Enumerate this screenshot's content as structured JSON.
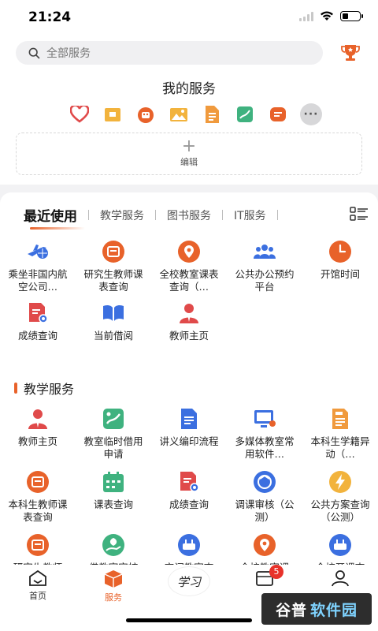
{
  "status": {
    "time": "21:24"
  },
  "search": {
    "placeholder": "全部服务"
  },
  "my_services": {
    "title": "我的服务",
    "edit_label": "编辑"
  },
  "tabs": [
    "最近使用",
    "教学服务",
    "图书服务",
    "IT服务"
  ],
  "recent": [
    {
      "name": "乘坐非国内航空公司…",
      "icon": "airplane-icon"
    },
    {
      "name": "研究生教师课表查询",
      "icon": "schedule-icon"
    },
    {
      "name": "全校教室课表查询（…",
      "icon": "location-pin-icon"
    },
    {
      "name": "公共办公预约平台",
      "icon": "people-icon"
    },
    {
      "name": "开馆时间",
      "icon": "clock-icon"
    },
    {
      "name": "成绩查询",
      "icon": "grade-search-icon"
    },
    {
      "name": "当前借阅",
      "icon": "book-icon"
    },
    {
      "name": "教师主页",
      "icon": "teacher-icon"
    }
  ],
  "teaching_section": {
    "title": "教学服务"
  },
  "teaching": [
    {
      "name": "教师主页",
      "icon": "teacher-icon"
    },
    {
      "name": "教室临时借用申请",
      "icon": "classroom-borrow-icon"
    },
    {
      "name": "讲义编印流程",
      "icon": "document-icon"
    },
    {
      "name": "多媒体教室常用软件…",
      "icon": "monitor-icon"
    },
    {
      "name": "本科生学籍异动（…",
      "icon": "student-status-icon"
    },
    {
      "name": "本科生教师课表查询",
      "icon": "schedule-icon"
    },
    {
      "name": "课表查询",
      "icon": "calendar-icon"
    },
    {
      "name": "成绩查询",
      "icon": "grade-search-icon"
    },
    {
      "name": "调课审核（公测）",
      "icon": "swap-icon"
    },
    {
      "name": "公共方案查询（公测）",
      "icon": "lightning-icon"
    },
    {
      "name": "研究生教师",
      "icon": "schedule-icon"
    },
    {
      "name": "借教室审核",
      "icon": "hand-leaf-icon"
    },
    {
      "name": "空闲教室查",
      "icon": "router-icon"
    },
    {
      "name": "全校教室课",
      "icon": "location-pin-icon"
    },
    {
      "name": "全校开课查",
      "icon": "router-icon"
    }
  ],
  "nav": {
    "home": "首页",
    "services": "服务",
    "logo_text": "学习",
    "messages_badge": "5"
  },
  "watermark": {
    "a": "谷普",
    "b": "软件园"
  },
  "colors": {
    "accent": "#e8622a",
    "blue": "#3b6fe0",
    "green": "#3fb27f"
  }
}
